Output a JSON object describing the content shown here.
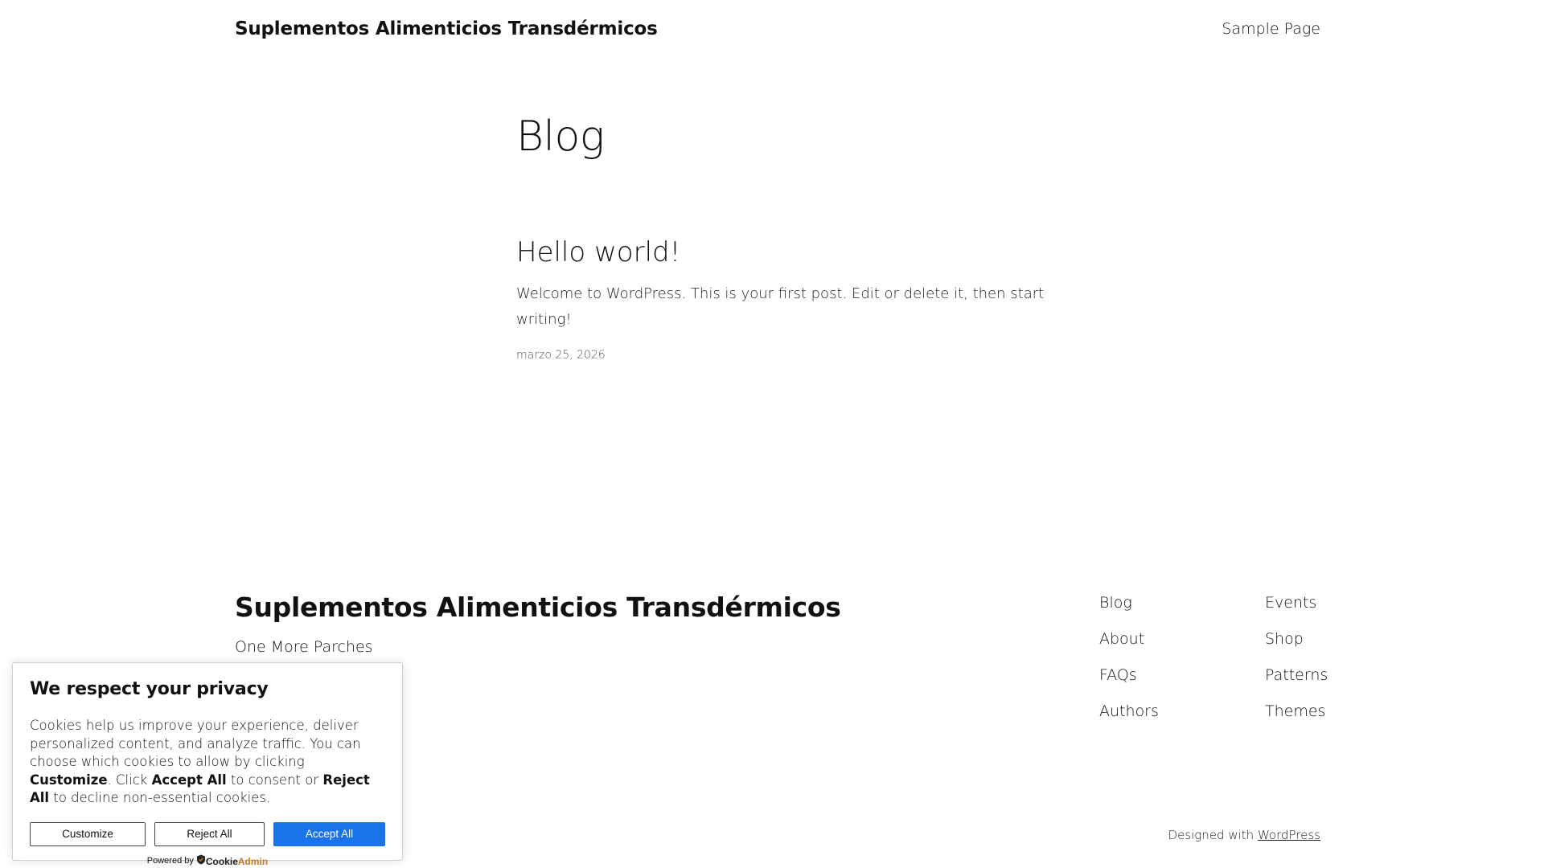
{
  "header": {
    "site_title": "Suplementos Alimenticios Transdérmicos",
    "nav": [
      "Sample Page"
    ]
  },
  "main": {
    "page_title": "Blog",
    "post": {
      "title": "Hello world!",
      "excerpt": "Welcome to WordPress. This is your first post. Edit or delete it, then start writing!",
      "date": "marzo 25, 2026"
    }
  },
  "footer": {
    "site_title": "Suplementos Alimenticios Transdérmicos",
    "tagline": "One More Parches",
    "nav_col1": [
      "Blog",
      "About",
      "FAQs",
      "Authors"
    ],
    "nav_col2": [
      "Events",
      "Shop",
      "Patterns",
      "Themes"
    ],
    "credits_prefix": "Designed with",
    "credits_link": "WordPress"
  },
  "cookie_banner": {
    "title": "We respect your privacy",
    "text_1": "Cookies help us improve your experience, deliver personalized content, and analyze traffic. You can choose which cookies to allow by clicking",
    "text_bold_1": "Customize",
    "text_2": ". Click",
    "text_bold_2": "Accept All",
    "text_3": "to consent or",
    "text_bold_3": "Reject All",
    "text_4": "to decline non-essential cookies.",
    "buttons": {
      "customize": "Customize",
      "reject": "Reject All",
      "accept": "Accept All"
    },
    "powered_by": "Powered by",
    "brand_a": "Cookie",
    "brand_b": "Admin",
    "accent_color": "#1a73e8",
    "brand_accent_color": "#c47b2a"
  }
}
